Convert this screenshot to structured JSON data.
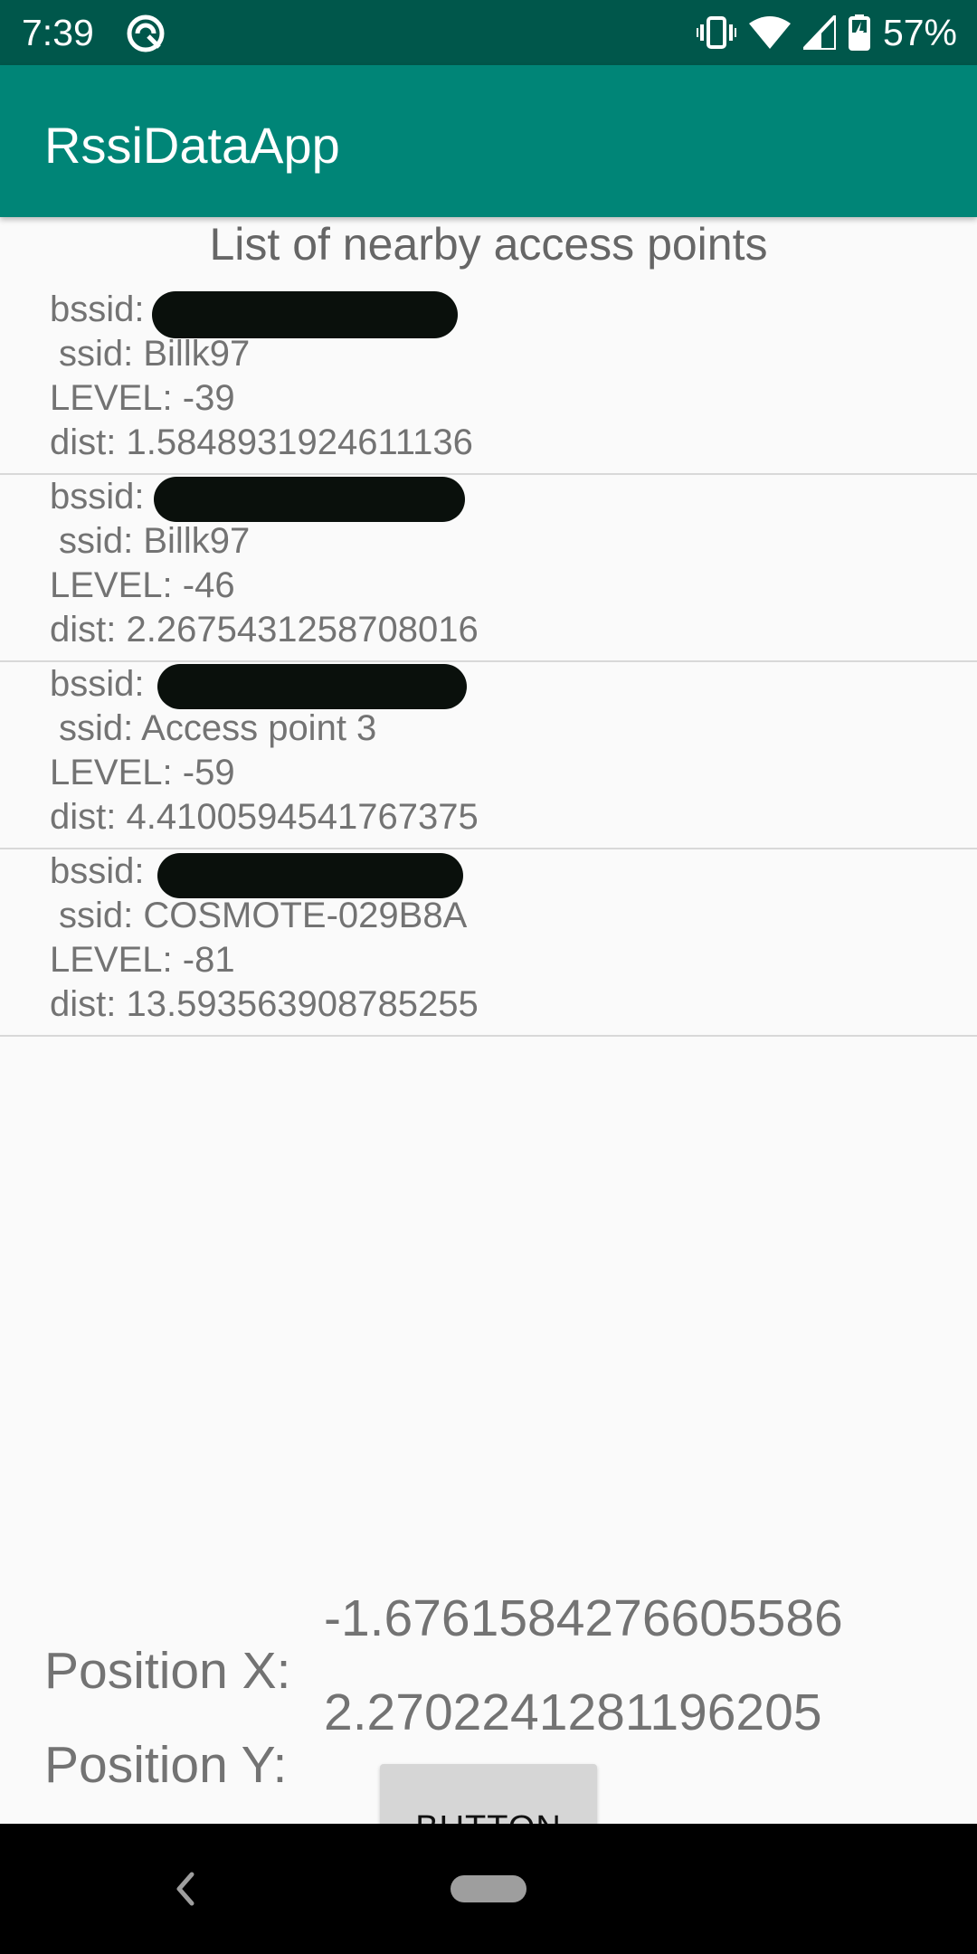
{
  "status_bar": {
    "time": "7:39",
    "battery_percent": "57%",
    "icons": [
      "sync-icon",
      "vibrate-icon",
      "wifi-icon",
      "cell-signal-icon",
      "battery-charging-icon"
    ]
  },
  "app_bar": {
    "title": "RssiDataApp"
  },
  "list": {
    "heading": "List of nearby access points",
    "items": [
      {
        "bssid_label": "bssid:",
        "ssid": "ssid: Billk97",
        "level": "LEVEL: -39",
        "dist": "dist: 1.5848931924611136"
      },
      {
        "bssid_label": "bssid:",
        "ssid": "ssid: Billk97",
        "level": "LEVEL: -46",
        "dist": "dist: 2.2675431258708016"
      },
      {
        "bssid_label": "bssid:",
        "ssid": "ssid: Access point 3",
        "level": "LEVEL: -59",
        "dist": "dist: 4.4100594541767375"
      },
      {
        "bssid_label": "bssid:",
        "ssid": "ssid: COSMOTE-029B8A",
        "level": "LEVEL: -81",
        "dist": "dist: 13.593563908785255"
      }
    ]
  },
  "position": {
    "x_label": "Position X:",
    "y_label": "Position Y:",
    "x_value": "-1.6761584276605586",
    "y_value": "2.2702241281196205"
  },
  "button": {
    "label": "BUTTON"
  },
  "colors": {
    "primary": "#008577",
    "primary_dark": "#00574b",
    "text": "#737373",
    "redaction": "#0a100c"
  }
}
